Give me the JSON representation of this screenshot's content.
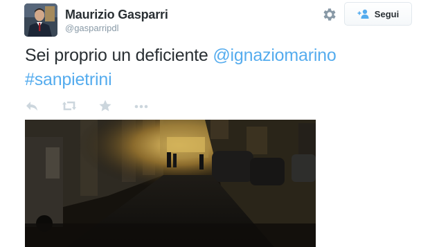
{
  "tweet": {
    "author": {
      "display_name": "Maurizio Gasparri",
      "handle": "@gasparripdl"
    },
    "follow_button_label": "Segui",
    "text_parts": [
      {
        "type": "text",
        "value": "Sei proprio un deficiente "
      },
      {
        "type": "mention",
        "value": "@ignaziomarino"
      },
      {
        "type": "hashtag",
        "value": "#sanpietrini"
      }
    ],
    "actions": [
      "reply-icon",
      "retweet-icon",
      "favorite-icon",
      "more-icon"
    ],
    "colors": {
      "link": "#55acee",
      "text": "#292f33",
      "muted": "#8899a6",
      "action_icon": "#ccd6dd"
    }
  }
}
